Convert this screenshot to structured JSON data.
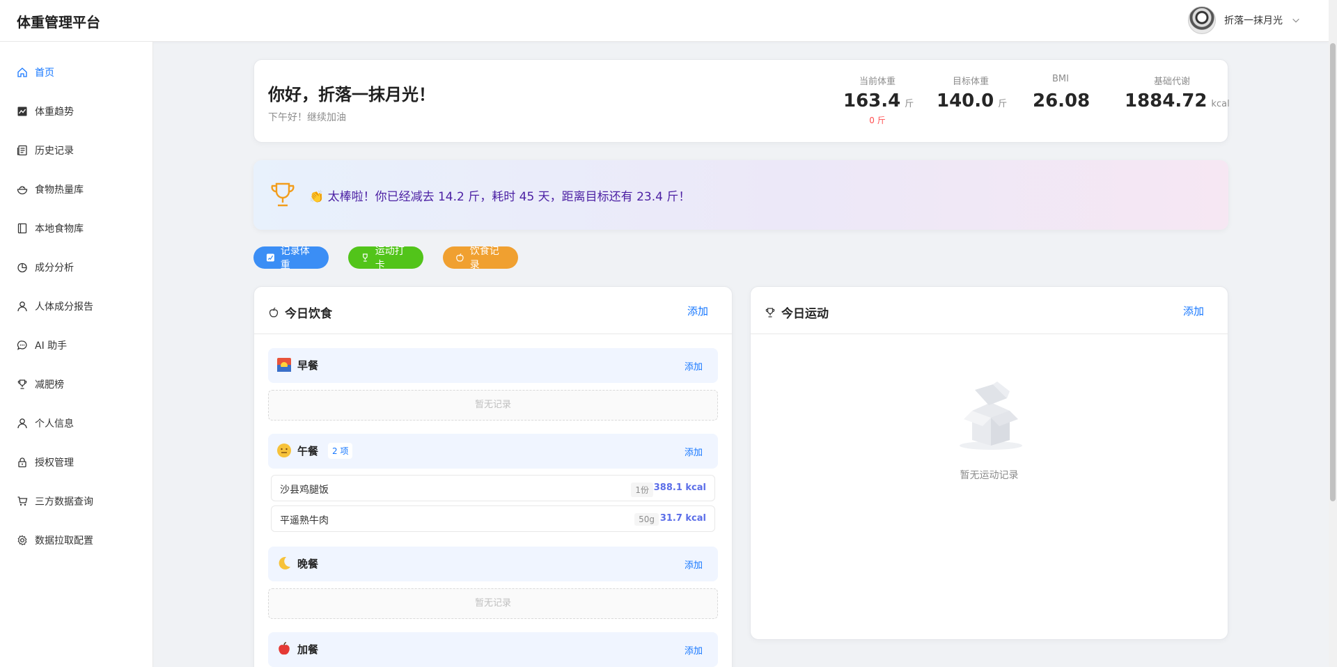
{
  "app": {
    "title": "体重管理平台"
  },
  "user": {
    "name": "折落一抹月光"
  },
  "sidebar": {
    "items": [
      {
        "label": "首页",
        "icon": "home-icon",
        "active": true
      },
      {
        "label": "体重趋势",
        "icon": "trend-icon"
      },
      {
        "label": "历史记录",
        "icon": "history-icon"
      },
      {
        "label": "食物热量库",
        "icon": "food-bowl-icon"
      },
      {
        "label": "本地食物库",
        "icon": "book-icon"
      },
      {
        "label": "成分分析",
        "icon": "pie-chart-icon"
      },
      {
        "label": "人体成分报告",
        "icon": "user-icon"
      },
      {
        "label": "AI 助手",
        "icon": "chat-icon"
      },
      {
        "label": "减肥榜",
        "icon": "trophy-icon"
      },
      {
        "label": "个人信息",
        "icon": "user-icon"
      },
      {
        "label": "授权管理",
        "icon": "lock-icon"
      },
      {
        "label": "三方数据查询",
        "icon": "cart-icon"
      },
      {
        "label": "数据拉取配置",
        "icon": "gear-icon"
      }
    ]
  },
  "welcome": {
    "greeting": "你好，折落一抹月光！",
    "sub": "下午好！继续加油",
    "stats": [
      {
        "label": "当前体重",
        "value": "163.4",
        "unit": "斤",
        "diff": "0 斤"
      },
      {
        "label": "目标体重",
        "value": "140.0",
        "unit": "斤"
      },
      {
        "label": "BMI",
        "value": "26.08",
        "unit": ""
      },
      {
        "label": "基础代谢",
        "value": "1884.72",
        "unit": "kcal"
      }
    ]
  },
  "banner": {
    "text": "👏 太棒啦！你已经减去 14.2 斤，耗时 45 天，距离目标还有 23.4 斤！"
  },
  "quick_actions": [
    {
      "label": "记录体重",
      "color": "#3b8ef5"
    },
    {
      "label": "运动打卡",
      "color": "#52c41a"
    },
    {
      "label": "饮食记录",
      "color": "#f0a030"
    }
  ],
  "diet": {
    "title": "今日饮食",
    "add_label": "添加",
    "meals": [
      {
        "name": "早餐",
        "add_label": "添加",
        "empty_text": "暂无记录"
      },
      {
        "name": "午餐",
        "add_label": "添加",
        "count": "2 项",
        "items": [
          {
            "name": "沙县鸡腿饭",
            "qty": "1份",
            "kcal": "388.1 kcal"
          },
          {
            "name": "平遥熟牛肉",
            "qty": "50g",
            "kcal": "31.7 kcal"
          }
        ]
      },
      {
        "name": "晚餐",
        "add_label": "添加",
        "empty_text": "暂无记录"
      },
      {
        "name": "加餐",
        "add_label": "添加"
      }
    ]
  },
  "sport": {
    "title": "今日运动",
    "add_label": "添加",
    "empty_text": "暂无运动记录"
  }
}
